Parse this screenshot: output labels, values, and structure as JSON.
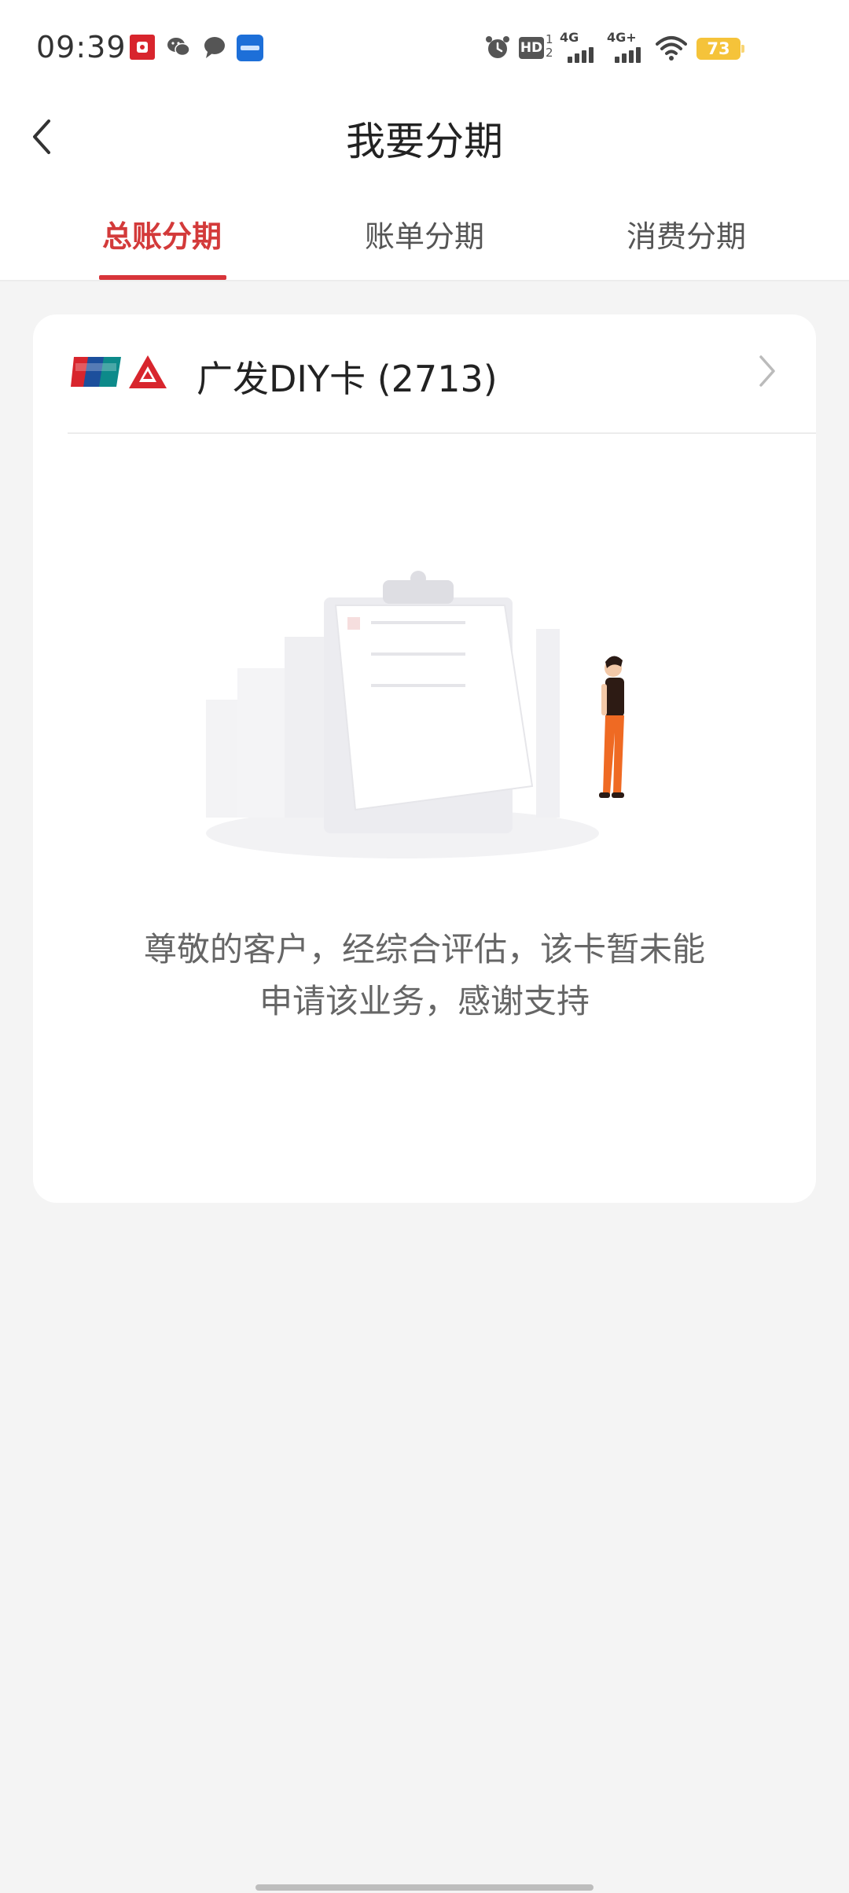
{
  "status_bar": {
    "time": "09:39",
    "hd_label": "HD",
    "hd_sub": "1\n2",
    "signal1": "4G",
    "signal2": "4G+",
    "battery": "73"
  },
  "header": {
    "title": "我要分期"
  },
  "tabs": [
    {
      "label": "总账分期",
      "active": true
    },
    {
      "label": "账单分期",
      "active": false
    },
    {
      "label": "消费分期",
      "active": false
    }
  ],
  "card": {
    "name": "广发DIY卡 (2713)",
    "message_line1": "尊敬的客户，经综合评估，该卡暂未能",
    "message_line2": "申请该业务，感谢支持"
  },
  "colors": {
    "accent": "#d33a3a",
    "page_bg": "#f4f4f4",
    "card_bg": "#ffffff"
  },
  "icons": [
    "back-arrow-icon",
    "chevron-right-icon",
    "unionpay-logo",
    "cgb-bank-logo",
    "empty-state-illustration"
  ]
}
